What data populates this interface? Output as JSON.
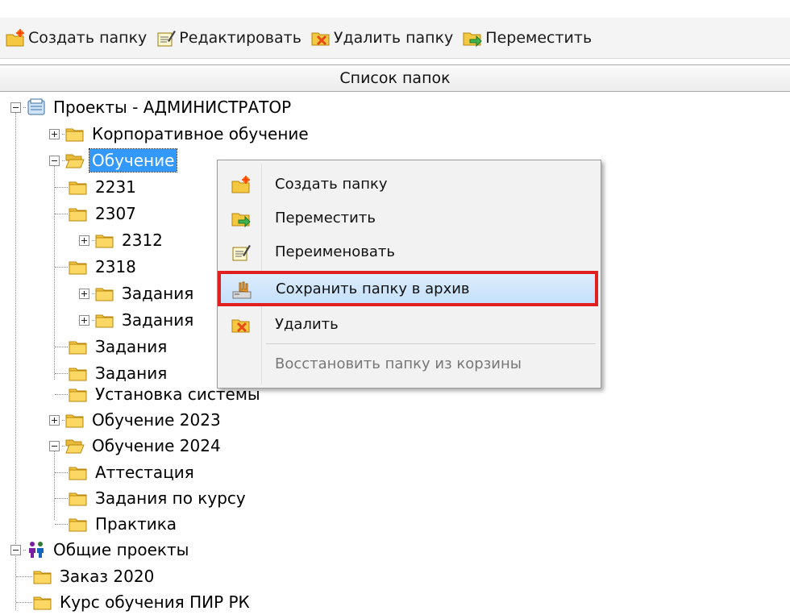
{
  "toolbar": {
    "buttons": [
      {
        "label": "Создать папку",
        "icon": "folder-new-icon"
      },
      {
        "label": "Редактировать",
        "icon": "edit-icon"
      },
      {
        "label": "Удалить папку",
        "icon": "folder-delete-icon"
      },
      {
        "label": "Переместить",
        "icon": "folder-move-icon"
      }
    ]
  },
  "panel": {
    "title": "Список папок"
  },
  "tree": {
    "items": [
      {
        "label": "Проекты - АДМИНИСТРАТОР",
        "icon": "projects-icon",
        "expanded": true
      },
      {
        "label": "Корпоративное обучение",
        "icon": "folder-icon",
        "expanded": false
      },
      {
        "label": "Обучение",
        "icon": "folder-open-icon",
        "expanded": true,
        "selected": true
      },
      {
        "label": "2231",
        "icon": "folder-icon"
      },
      {
        "label": "2307",
        "icon": "folder-icon"
      },
      {
        "label": "2312",
        "icon": "folder-icon",
        "expanded": false
      },
      {
        "label": "2318",
        "icon": "folder-icon"
      },
      {
        "label": "Задания",
        "icon": "folder-icon",
        "expanded": false
      },
      {
        "label": "Задания",
        "icon": "folder-icon",
        "expanded": false
      },
      {
        "label": "Задания",
        "icon": "folder-icon"
      },
      {
        "label": "Задания",
        "icon": "folder-icon"
      },
      {
        "label": "Установка системы",
        "icon": "folder-icon"
      },
      {
        "label": "Обучение 2023",
        "icon": "folder-icon",
        "expanded": false
      },
      {
        "label": "Обучение 2024",
        "icon": "folder-open-icon",
        "expanded": true
      },
      {
        "label": "Аттестация",
        "icon": "folder-icon"
      },
      {
        "label": "Задания по курсу",
        "icon": "folder-icon"
      },
      {
        "label": "Практика",
        "icon": "folder-icon"
      },
      {
        "label": "Общие проекты",
        "icon": "shared-projects-icon",
        "expanded": true
      },
      {
        "label": "Заказ 2020",
        "icon": "folder-icon"
      },
      {
        "label": "Курс обучения ПИР РК",
        "icon": "folder-icon"
      }
    ]
  },
  "context_menu": {
    "items": [
      {
        "label": "Создать папку",
        "icon": "folder-new-icon"
      },
      {
        "label": "Переместить",
        "icon": "folder-move-icon"
      },
      {
        "label": "Переименовать",
        "icon": "rename-icon"
      },
      {
        "label": "Сохранить папку в архив",
        "icon": "archive-icon",
        "highlighted": true
      },
      {
        "label": "Удалить",
        "icon": "delete-icon"
      },
      {
        "label": "Восстановить папку из корзины",
        "disabled": true
      }
    ]
  },
  "colors": {
    "selection": "#3399ff",
    "highlight_frame": "#e02020",
    "folder": "#f5c842"
  }
}
